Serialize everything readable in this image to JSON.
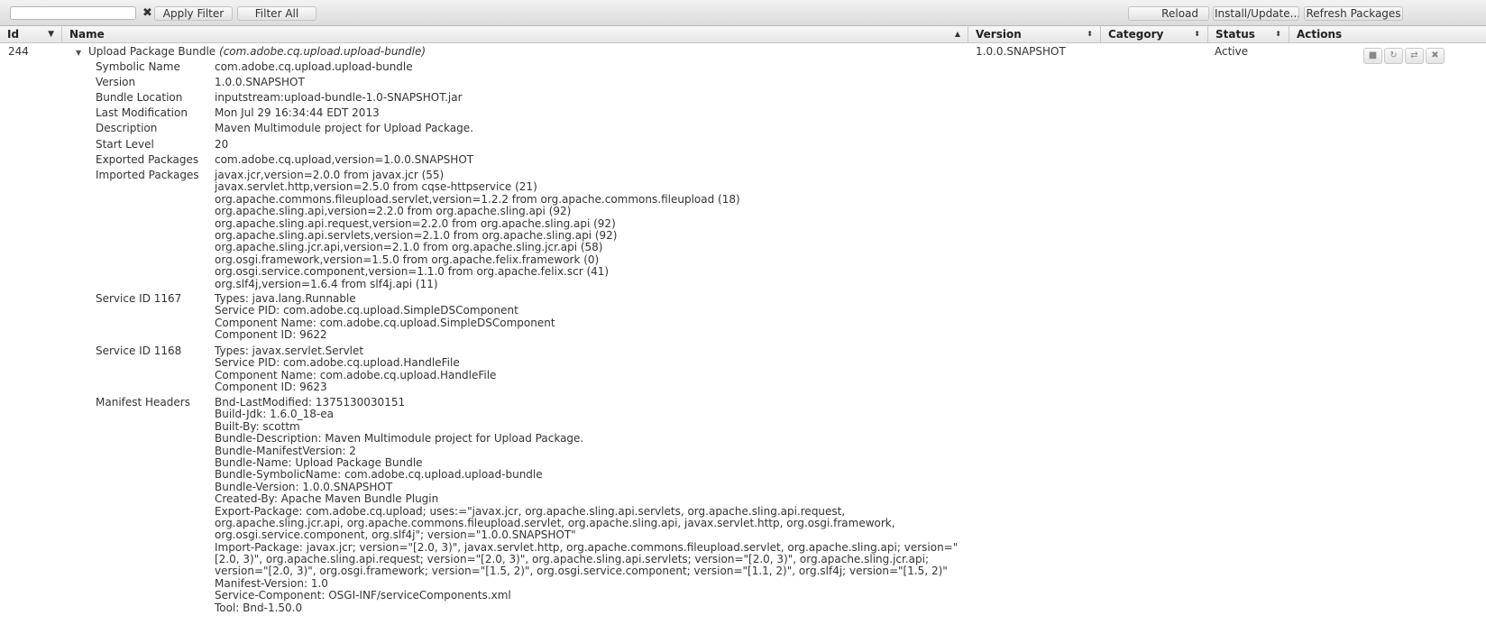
{
  "toolbar": {
    "search_value": "",
    "clear_icon": "close-icon",
    "apply_filter": "Apply Filter",
    "filter_all": "Filter All",
    "reload": "Reload",
    "install_update": "Install/Update...",
    "refresh_packages": "Refresh Packages"
  },
  "columns": {
    "id": "Id",
    "name": "Name",
    "version": "Version",
    "category": "Category",
    "status": "Status",
    "actions": "Actions"
  },
  "bundle": {
    "id": "244",
    "name": "Upload Package Bundle",
    "symbolic_paren": "(com.adobe.cq.upload.upload-bundle)",
    "version": "1.0.0.SNAPSHOT",
    "category": "",
    "status": "Active",
    "actions": [
      {
        "name": "stop-icon",
        "glyph": "■"
      },
      {
        "name": "refresh-icon",
        "glyph": "↻"
      },
      {
        "name": "update-icon",
        "glyph": "⇄"
      },
      {
        "name": "trash-icon",
        "glyph": "🗑"
      }
    ]
  },
  "details": [
    {
      "label": "Symbolic Name",
      "values": [
        "com.adobe.cq.upload.upload-bundle"
      ]
    },
    {
      "label": "Version",
      "values": [
        "1.0.0.SNAPSHOT"
      ]
    },
    {
      "label": "Bundle Location",
      "values": [
        "inputstream:upload-bundle-1.0-SNAPSHOT.jar"
      ]
    },
    {
      "label": "Last Modification",
      "values": [
        "Mon Jul 29 16:34:44 EDT 2013"
      ]
    },
    {
      "label": "Description",
      "values": [
        "Maven Multimodule project for Upload Package."
      ]
    },
    {
      "label": "Start Level",
      "values": [
        "20"
      ]
    },
    {
      "label": "Exported Packages",
      "values": [
        "com.adobe.cq.upload,version=1.0.0.SNAPSHOT"
      ]
    },
    {
      "label": "Imported Packages",
      "values": [
        "javax.jcr,version=2.0.0 from javax.jcr (55)",
        "javax.servlet.http,version=2.5.0 from cqse-httpservice (21)",
        "org.apache.commons.fileupload.servlet,version=1.2.2 from org.apache.commons.fileupload (18)",
        "org.apache.sling.api,version=2.2.0 from org.apache.sling.api (92)",
        "org.apache.sling.api.request,version=2.2.0 from org.apache.sling.api (92)",
        "org.apache.sling.api.servlets,version=2.1.0 from org.apache.sling.api (92)",
        "org.apache.sling.jcr.api,version=2.1.0 from org.apache.sling.jcr.api (58)",
        "org.osgi.framework,version=1.5.0 from org.apache.felix.framework (0)",
        "org.osgi.service.component,version=1.1.0 from org.apache.felix.scr (41)",
        "org.slf4j,version=1.6.4 from slf4j.api (11)"
      ]
    },
    {
      "label": "Service ID 1167",
      "values": [
        "Types: java.lang.Runnable",
        "Service PID: com.adobe.cq.upload.SimpleDSComponent",
        "Component Name: com.adobe.cq.upload.SimpleDSComponent",
        "Component ID: 9622"
      ]
    },
    {
      "label": "Service ID 1168",
      "values": [
        "Types: javax.servlet.Servlet",
        "Service PID: com.adobe.cq.upload.HandleFile",
        "Component Name: com.adobe.cq.upload.HandleFile",
        "Component ID: 9623"
      ]
    },
    {
      "label": "Manifest Headers",
      "values": [
        "Bnd-LastModified: 1375130030151",
        "Build-Jdk: 1.6.0_18-ea",
        "Built-By: scottm",
        "Bundle-Description: Maven Multimodule project for Upload Package.",
        "Bundle-ManifestVersion: 2",
        "Bundle-Name: Upload Package Bundle",
        "Bundle-SymbolicName: com.adobe.cq.upload.upload-bundle",
        "Bundle-Version: 1.0.0.SNAPSHOT",
        "Created-By: Apache Maven Bundle Plugin",
        "Export-Package: com.adobe.cq.upload; uses:=\"javax.jcr, org.apache.sling.api.servlets, org.apache.sling.api.request,",
        "org.apache.sling.jcr.api, org.apache.commons.fileupload.servlet, org.apache.sling.api, javax.servlet.http, org.osgi.framework,",
        "org.osgi.service.component, org.slf4j\"; version=\"1.0.0.SNAPSHOT\"",
        "Import-Package: javax.jcr; version=\"[2.0, 3)\", javax.servlet.http, org.apache.commons.fileupload.servlet, org.apache.sling.api; version=\"",
        "[2.0, 3)\", org.apache.sling.api.request; version=\"[2.0, 3)\", org.apache.sling.api.servlets; version=\"[2.0, 3)\", org.apache.sling.jcr.api;",
        "version=\"[2.0, 3)\", org.osgi.framework; version=\"[1.5, 2)\", org.osgi.service.component; version=\"[1.1, 2)\", org.slf4j; version=\"[1.5, 2)\"",
        "Manifest-Version: 1.0",
        "Service-Component: OSGI-INF/serviceComponents.xml",
        "Tool: Bnd-1.50.0"
      ]
    }
  ]
}
